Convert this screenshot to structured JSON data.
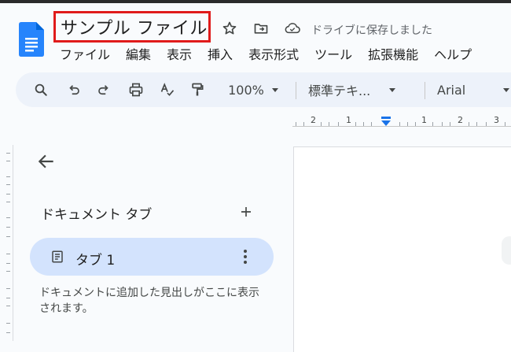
{
  "document": {
    "title": "サンプル ファイル",
    "save_status": "ドライブに保存しました"
  },
  "menu": [
    "ファイル",
    "編集",
    "表示",
    "挿入",
    "表示形式",
    "ツール",
    "拡張機能",
    "ヘルプ"
  ],
  "toolbar": {
    "zoom": "100%",
    "style": "標準テキ...",
    "font": "Arial"
  },
  "ruler": {
    "labels": [
      "2",
      "1",
      "1",
      "2",
      "3"
    ]
  },
  "sidebar": {
    "section_title": "ドキュメント タブ",
    "tabs": [
      {
        "label": "タブ 1"
      }
    ],
    "hint": "ドキュメントに追加した見出しがここに表示されます。"
  },
  "colors": {
    "accent": "#1a73e8",
    "tab_selected": "#d3e3fd",
    "highlight_box": "#e01b1b"
  }
}
